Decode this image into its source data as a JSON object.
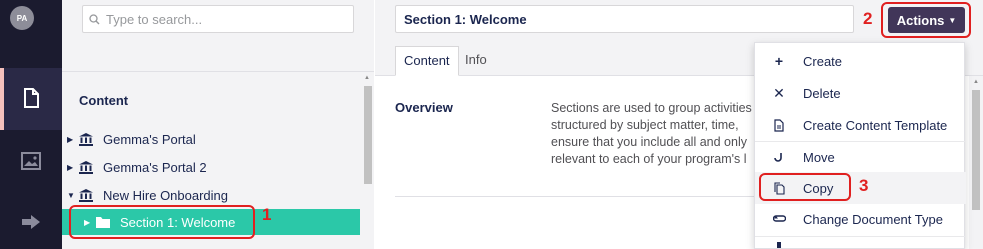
{
  "rail": {
    "avatar_initials": "PA",
    "sections": [
      {
        "name": "content",
        "icon": "document-icon",
        "active": true
      },
      {
        "name": "media",
        "icon": "image-icon",
        "active": false
      },
      {
        "name": "forward",
        "icon": "arrow-right-icon",
        "active": false
      }
    ]
  },
  "tree": {
    "search_placeholder": "Type to search...",
    "header": "Content",
    "nodes": [
      {
        "label": "Gemma's Portal",
        "icon": "institution-icon",
        "expanded": false
      },
      {
        "label": "Gemma's Portal 2",
        "icon": "institution-icon",
        "expanded": false
      },
      {
        "label": "New Hire Onboarding",
        "icon": "institution-icon",
        "expanded": true
      },
      {
        "label": "Section 1: Welcome",
        "icon": "folder-icon",
        "expanded": false,
        "selected": true
      }
    ]
  },
  "editor": {
    "name_value": "Section 1: Welcome",
    "tabs": [
      {
        "label": "Content",
        "active": true
      },
      {
        "label": "Info",
        "active": false
      }
    ],
    "overview_label": "Overview",
    "overview_lines": [
      "Sections are used to group activities",
      "structured by subject matter, time,",
      "ensure that you include all and only",
      "relevant to each of your program's l"
    ]
  },
  "actions": {
    "label": "Actions"
  },
  "menu": {
    "items": [
      {
        "label": "Create",
        "icon": "plus-icon"
      },
      {
        "label": "Delete",
        "icon": "close-icon"
      },
      {
        "label": "Create Content Template",
        "icon": "template-doc-icon"
      },
      {
        "label": "Move",
        "icon": "move-hook-icon"
      },
      {
        "label": "Copy",
        "icon": "copy-doc-icon",
        "hover": true
      },
      {
        "label": "Change Document Type",
        "icon": "swap-arrows-icon"
      }
    ]
  },
  "annotations": {
    "step1": "1",
    "step2": "2",
    "step3": "3",
    "color": "#e02020"
  },
  "colors": {
    "rail_bg": "#1b1b2f",
    "selected_node": "#2bc8a8",
    "actions_button": "#413659",
    "text_primary": "#1b264f"
  }
}
